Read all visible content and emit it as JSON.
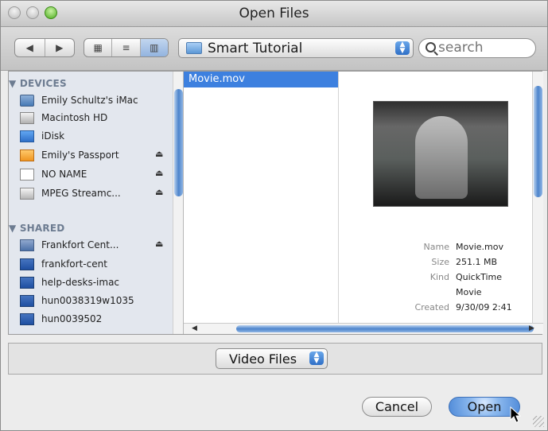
{
  "window": {
    "title": "Open Files"
  },
  "toolbar": {
    "nav": {
      "back_icon": "back-arrow-icon",
      "forward_icon": "forward-arrow-icon"
    },
    "view_modes": [
      {
        "name": "icon-view",
        "icon": "grid-icon"
      },
      {
        "name": "list-view",
        "icon": "list-icon"
      },
      {
        "name": "column-view",
        "icon": "columns-icon"
      }
    ],
    "path_popup": {
      "value": "Smart Tutorial"
    },
    "search": {
      "placeholder": "search"
    }
  },
  "sidebar": {
    "sections": [
      {
        "title": "DEVICES",
        "items": [
          {
            "label": "Emily Schultz's iMac",
            "icon": "imac-icon",
            "eject": false
          },
          {
            "label": "Macintosh HD",
            "icon": "hard-drive-icon",
            "eject": false
          },
          {
            "label": "iDisk",
            "icon": "idisk-icon",
            "eject": false
          },
          {
            "label": "Emily's Passport",
            "icon": "external-drive-icon",
            "eject": true
          },
          {
            "label": "NO NAME",
            "icon": "blank-disk-icon",
            "eject": true
          },
          {
            "label": "MPEG Streamc...",
            "icon": "drive-icon",
            "eject": true
          }
        ]
      },
      {
        "title": "SHARED",
        "items": [
          {
            "label": "Frankfort Cent...",
            "icon": "network-mac-icon",
            "eject": true
          },
          {
            "label": "frankfort-cent",
            "icon": "display-icon",
            "eject": false
          },
          {
            "label": "help-desks-imac",
            "icon": "display-icon",
            "eject": false
          },
          {
            "label": "hun0038319w1035",
            "icon": "display-icon",
            "eject": false
          },
          {
            "label": "hun0039502",
            "icon": "display-icon",
            "eject": false
          }
        ]
      }
    ]
  },
  "file_list": {
    "selected": "Movie.mov"
  },
  "preview": {
    "details": [
      {
        "label": "Name",
        "value": "Movie.mov"
      },
      {
        "label": "Size",
        "value": "251.1 MB"
      },
      {
        "label": "Kind",
        "value": "QuickTime"
      },
      {
        "label": "",
        "value": "Movie"
      },
      {
        "label": "Created",
        "value": "9/30/09 2:41"
      }
    ]
  },
  "filter": {
    "value": "Video Files"
  },
  "buttons": {
    "cancel": "Cancel",
    "open": "Open"
  },
  "colors": {
    "selection": "#3d80df",
    "primary_button": "#6ba0e5",
    "sidebar_bg": "#e3e7ee"
  }
}
